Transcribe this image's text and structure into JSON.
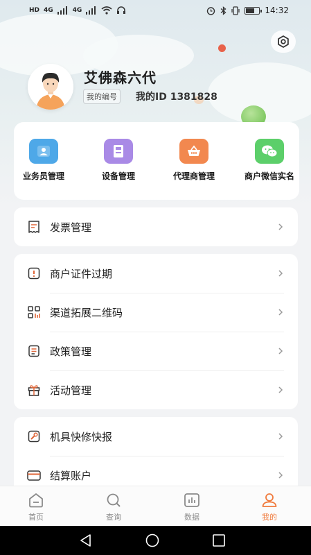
{
  "status_bar": {
    "time": "14:32",
    "signal_1": "4G",
    "signal_2": "4G"
  },
  "profile": {
    "name": "艾佛森六代",
    "id_tag": "我的编号",
    "id_text": "我的ID 1381828"
  },
  "quick_menu": [
    {
      "label": "业务员管理",
      "icon": "person-card-icon",
      "color": "#4ea8e8"
    },
    {
      "label": "设备管理",
      "icon": "device-icon",
      "color": "#a98ae6"
    },
    {
      "label": "代理商管理",
      "icon": "basket-icon",
      "color": "#f2884f"
    },
    {
      "label": "商户微信实名",
      "icon": "wechat-icon",
      "color": "#5ccf6a"
    }
  ],
  "list_1": [
    {
      "label": "发票管理",
      "icon": "invoice-icon"
    }
  ],
  "list_2": [
    {
      "label": "商户证件过期",
      "icon": "alert-icon"
    },
    {
      "label": "渠道拓展二维码",
      "icon": "qrcode-icon"
    },
    {
      "label": "政策管理",
      "icon": "document-icon"
    },
    {
      "label": "活动管理",
      "icon": "gift-icon"
    }
  ],
  "list_3": [
    {
      "label": "机具快修快报",
      "icon": "repair-icon"
    },
    {
      "label": "结算账户",
      "icon": "card-icon"
    }
  ],
  "tabbar": [
    {
      "label": "首页",
      "icon": "home-icon"
    },
    {
      "label": "查询",
      "icon": "search-icon"
    },
    {
      "label": "数据",
      "icon": "chart-icon"
    },
    {
      "label": "我的",
      "icon": "user-icon",
      "active": true
    }
  ],
  "colors": {
    "accent": "#f07a3c",
    "background": "#f2f3f5"
  },
  "battery_level": 0.7
}
